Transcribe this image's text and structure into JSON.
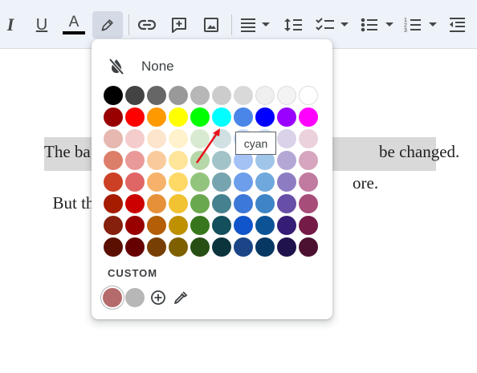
{
  "toolbar": {
    "italic_label": "I",
    "underline_label": "U",
    "text_color_label": "A",
    "text_color_swatch": "#000000"
  },
  "document": {
    "line1_start": "The ba",
    "line1_end": "be changed.",
    "line2_start": "But th",
    "line2_end": "ore."
  },
  "palette": {
    "none_label": "None",
    "colors": [
      [
        "#000000",
        "#434343",
        "#666666",
        "#999999",
        "#b7b7b7",
        "#cccccc",
        "#d9d9d9",
        "#efefef",
        "#f3f3f3",
        "#ffffff"
      ],
      [
        "#980000",
        "#ff0000",
        "#ff9900",
        "#ffff00",
        "#00ff00",
        "#00ffff",
        "#4a86e8",
        "#0000ff",
        "#9900ff",
        "#ff00ff"
      ],
      [
        "#e6b8af",
        "#f4cccc",
        "#fce5cd",
        "#fff2cc",
        "#d9ead3",
        "#d0e0e3",
        "#c9daf8",
        "#cfe2f3",
        "#d9d2e9",
        "#ead1dc"
      ],
      [
        "#dd7e6b",
        "#ea9999",
        "#f9cb9c",
        "#ffe599",
        "#b6d7a8",
        "#a2c4c9",
        "#a4c2f4",
        "#9fc5e8",
        "#b4a7d6",
        "#d5a6bd"
      ],
      [
        "#cc4125",
        "#e06666",
        "#f6b26b",
        "#ffd966",
        "#93c47d",
        "#76a5af",
        "#6d9eeb",
        "#6fa8dc",
        "#8e7cc3",
        "#c27ba0"
      ],
      [
        "#a61c00",
        "#cc0000",
        "#e69138",
        "#f1c232",
        "#6aa84f",
        "#45818e",
        "#3c78d8",
        "#3d85c6",
        "#674ea7",
        "#a64d79"
      ],
      [
        "#85200c",
        "#990000",
        "#b45f06",
        "#bf9000",
        "#38761d",
        "#134f5c",
        "#1155cc",
        "#0b5394",
        "#351c75",
        "#741b47"
      ],
      [
        "#5b0f00",
        "#660000",
        "#783f04",
        "#7f6000",
        "#274e13",
        "#0c343d",
        "#1c4587",
        "#073763",
        "#20124d",
        "#4c1130"
      ]
    ],
    "custom_label": "CUSTOM",
    "custom_colors": [
      "#b56b6b",
      "#b7b7b7"
    ],
    "tooltip": "cyan"
  }
}
